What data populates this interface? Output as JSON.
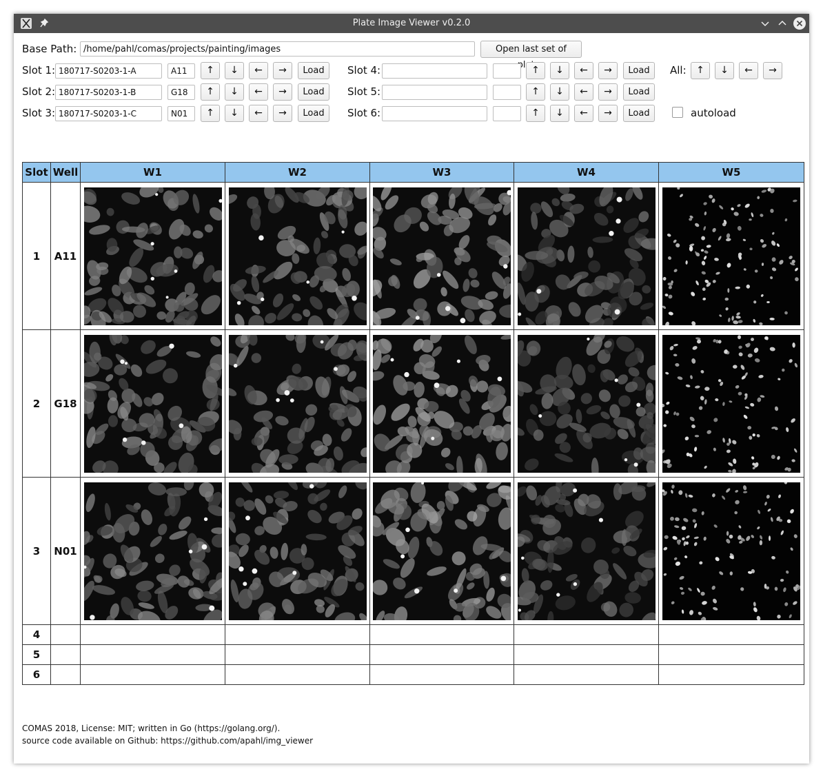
{
  "window": {
    "title": "Plate Image Viewer v0.2.0"
  },
  "base_path": {
    "label": "Base Path:",
    "value": "/home/pahl/comas/projects/painting/images",
    "open_last_label": "Open last set of plates"
  },
  "slots": [
    {
      "label": "Slot 1:",
      "plate": "180717-S0203-1-A",
      "well": "A11"
    },
    {
      "label": "Slot 2:",
      "plate": "180717-S0203-1-B",
      "well": "G18"
    },
    {
      "label": "Slot 3:",
      "plate": "180717-S0203-1-C",
      "well": "N01"
    },
    {
      "label": "Slot 4:",
      "plate": "",
      "well": ""
    },
    {
      "label": "Slot 5:",
      "plate": "",
      "well": ""
    },
    {
      "label": "Slot 6:",
      "plate": "",
      "well": ""
    }
  ],
  "buttons": {
    "up": "↑",
    "down": "↓",
    "left": "←",
    "right": "→",
    "load": "Load"
  },
  "all": {
    "label": "All:"
  },
  "autoload": {
    "label": "autoload",
    "checked": false
  },
  "table": {
    "headers": [
      "Slot",
      "Well",
      "W1",
      "W2",
      "W3",
      "W4",
      "W5"
    ],
    "rows": [
      {
        "slot": "1",
        "well": "A11"
      },
      {
        "slot": "2",
        "well": "G18"
      },
      {
        "slot": "3",
        "well": "N01"
      },
      {
        "slot": "4",
        "well": ""
      },
      {
        "slot": "5",
        "well": ""
      },
      {
        "slot": "6",
        "well": ""
      }
    ],
    "header_color": "#94c6ee"
  },
  "footer": {
    "line1": "COMAS 2018, License: MIT; written in Go (https://golang.org/).",
    "line2": "source code available on Github: https://github.com/apahl/img_viewer"
  }
}
